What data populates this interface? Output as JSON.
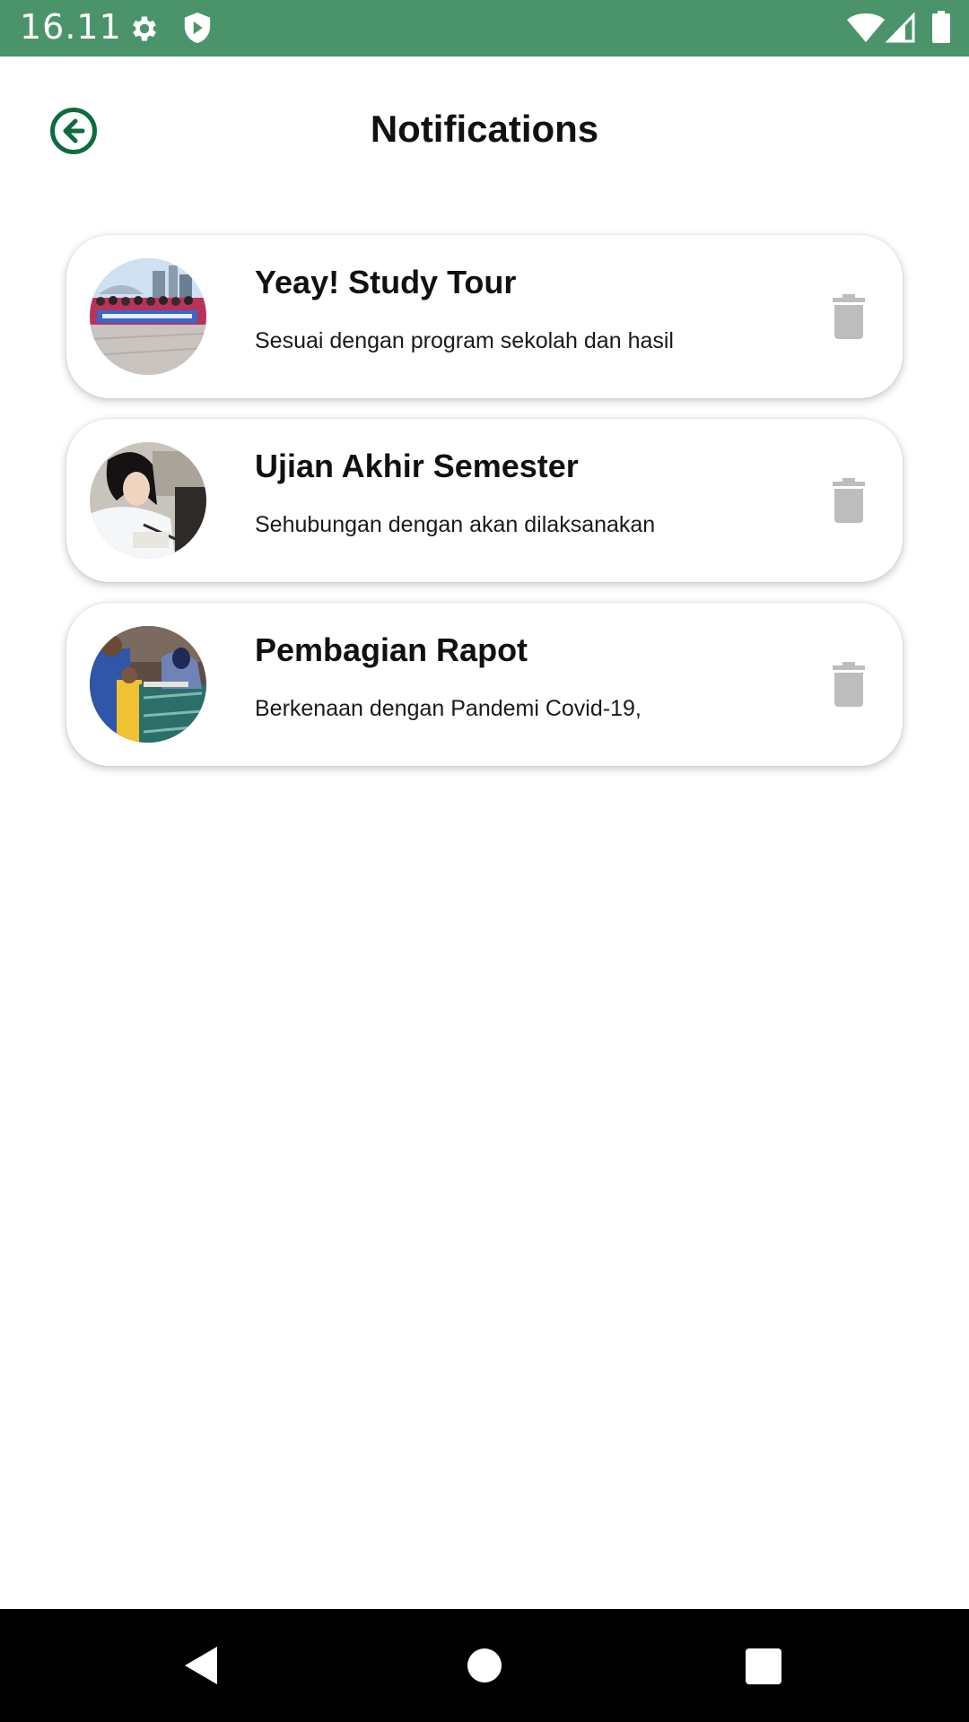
{
  "status_bar": {
    "time": "16.11",
    "icons": [
      "gear-icon",
      "shield-icon",
      "wifi-icon",
      "signal-icon",
      "battery-icon"
    ],
    "color": "#4b946b"
  },
  "header": {
    "title": "Notifications",
    "back_icon": "arrow-left-circle-icon",
    "accent_color": "#0f6b3f"
  },
  "notifications": [
    {
      "title": "Yeay! Study Tour",
      "body": "Sesuai dengan program sekolah dan hasil",
      "avatar": "study-tour-photo"
    },
    {
      "title": "Ujian Akhir Semester",
      "body": "Sehubungan dengan akan dilaksanakan",
      "avatar": "student-writing-photo"
    },
    {
      "title": "Pembagian Rapot",
      "body": "Berkenaan dengan Pandemi Covid-19,",
      "avatar": "report-card-meeting-photo"
    }
  ],
  "delete_icon": "trash-icon",
  "delete_icon_color": "#bdbdbd",
  "nav_bar": {
    "icons": [
      "nav-back-icon",
      "nav-home-icon",
      "nav-recents-icon"
    ]
  }
}
